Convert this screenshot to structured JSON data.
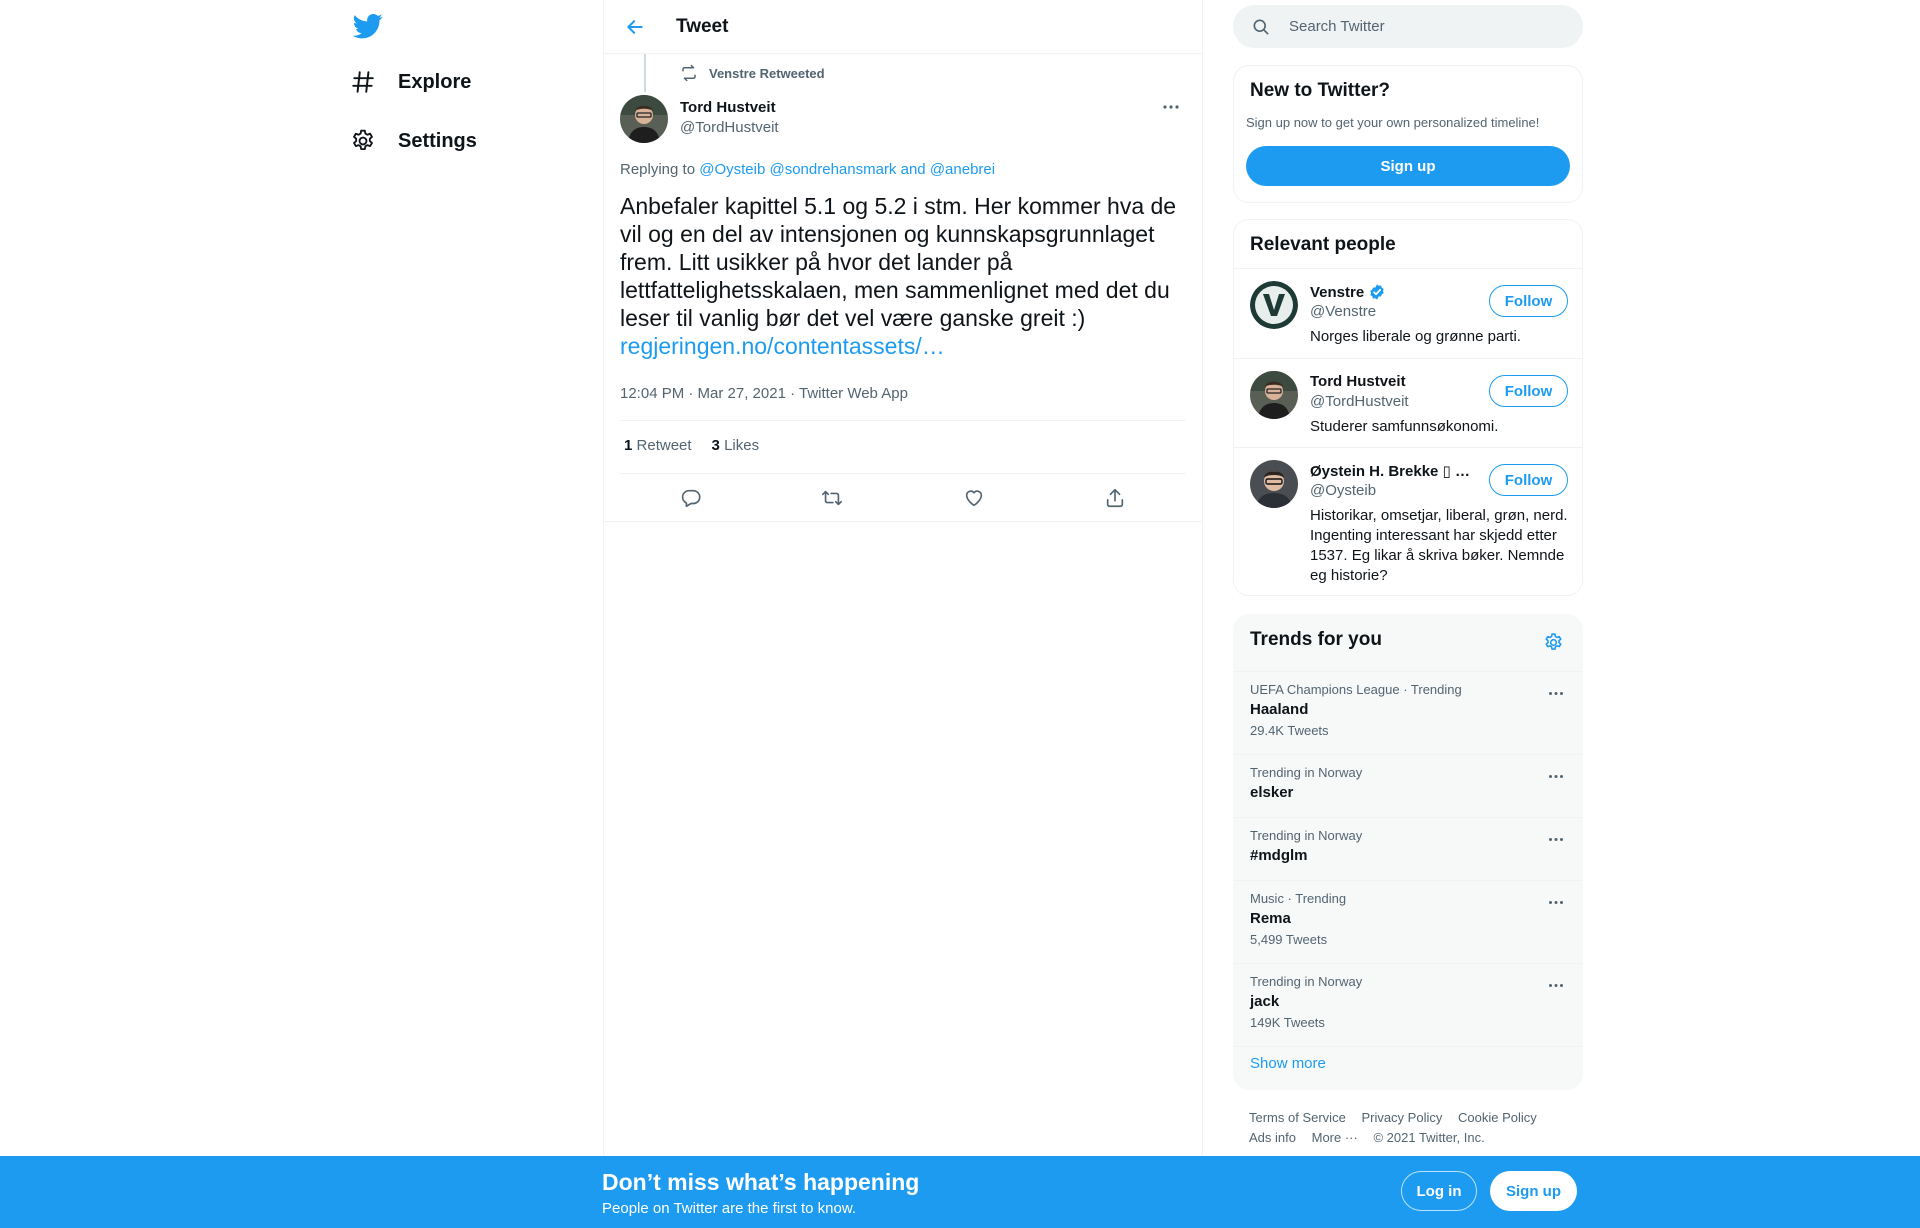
{
  "colors": {
    "accent": "#1d9bf0",
    "text": "#0f1419",
    "secondary": "#536471",
    "banner": "#1d9bf0"
  },
  "nav": {
    "logo_icon": "twitter-bird-icon",
    "items": [
      {
        "label": "Explore",
        "icon": "hashtag-icon"
      },
      {
        "label": "Settings",
        "icon": "gear-icon"
      }
    ]
  },
  "header": {
    "title": "Tweet"
  },
  "tweet": {
    "retweeted_by": "Venstre Retweeted",
    "author_name": "Tord Hustveit",
    "author_handle": "@TordHustveit",
    "replying_prefix": "Replying to",
    "replying_to_1": "@Oysteib",
    "replying_to_2": "@sondrehansmark",
    "replying_and": "and",
    "replying_to_3": "@anebrei",
    "text": "Anbefaler kapittel 5.1 og 5.2 i stm. Her kommer hva de vil og en del av intensjonen og kunnskapsgrunnlaget frem. Litt usikker på hvor det lander på lettfattelighetsskalaen, men sammenlignet med det du leser til vanlig bør det vel være ganske greit :)",
    "link": "regjeringen.no/contentassets/…",
    "meta": "12:04 PM · Mar 27, 2021 · Twitter Web App",
    "retweets_count": "1",
    "retweets_label": "Retweet",
    "likes_count": "3",
    "likes_label": "Likes"
  },
  "search": {
    "placeholder": "Search Twitter"
  },
  "new_to_twitter": {
    "title": "New to Twitter?",
    "subtitle": "Sign up now to get your own personalized timeline!",
    "signup_label": "Sign up"
  },
  "relevant_people": {
    "title": "Relevant people",
    "follow_label": "Follow",
    "people": [
      {
        "name": "Venstre",
        "handle": "@Venstre",
        "bio": "Norges liberale og grønne parti.",
        "verified": true
      },
      {
        "name": "Tord Hustveit",
        "handle": "@TordHustveit",
        "bio": "Studerer samfunnsøkonomi.",
        "verified": false
      },
      {
        "name": "Øystein H. Brekke ▯ …",
        "handle": "@Oysteib",
        "bio": "Historikar, omsetjar, liberal, grøn, nerd. Ingenting interessant har skjedd etter 1537. Eg likar å skriva bøker. Nemnde eg historie?",
        "verified": false
      }
    ]
  },
  "trends": {
    "title": "Trends for you",
    "items": [
      {
        "context": "UEFA Champions League · Trending",
        "name": "Haaland",
        "count": "29.4K Tweets"
      },
      {
        "context": "Trending in Norway",
        "name": "elsker",
        "count": ""
      },
      {
        "context": "Trending in Norway",
        "name": "#mdglm",
        "count": ""
      },
      {
        "context": "Music · Trending",
        "name": "Rema",
        "count": "5,499 Tweets"
      },
      {
        "context": "Trending in Norway",
        "name": "jack",
        "count": "149K Tweets"
      }
    ],
    "show_more": "Show more"
  },
  "footer": {
    "terms": "Terms of Service",
    "privacy": "Privacy Policy",
    "cookie": "Cookie Policy",
    "ads": "Ads info",
    "more": "More ···",
    "copyright": "© 2021 Twitter, Inc."
  },
  "bottom_bar": {
    "title": "Don’t miss what’s happening",
    "subtitle": "People on Twitter are the first to know.",
    "login_label": "Log in",
    "signup_label": "Sign up"
  }
}
